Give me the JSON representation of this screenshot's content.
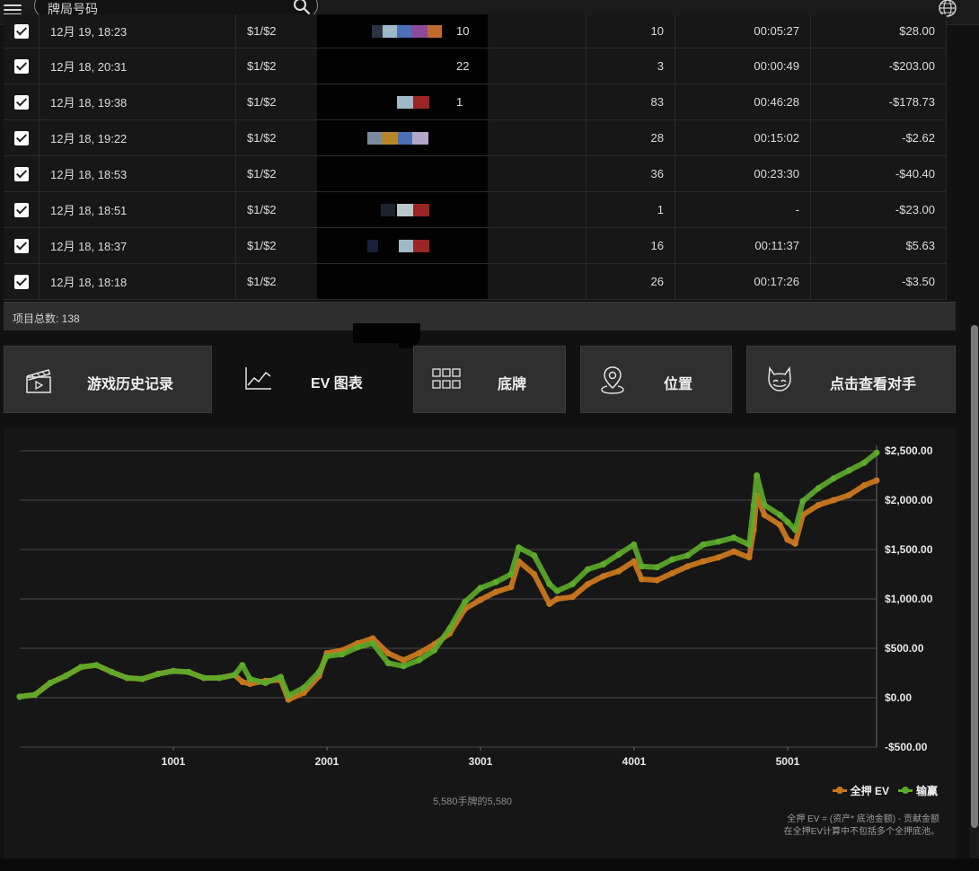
{
  "search": {
    "placeholder": "牌局号码"
  },
  "table": {
    "rows": [
      {
        "date": "12月 19, 18:23",
        "stakes": "$1/$2",
        "tail": "10",
        "hands": "10",
        "duration": "00:05:27",
        "net": "$28.00"
      },
      {
        "date": "12月 18, 20:31",
        "stakes": "$1/$2",
        "tail": "22",
        "hands": "3",
        "duration": "00:00:49",
        "net": "-$203.00"
      },
      {
        "date": "12月 18, 19:38",
        "stakes": "$1/$2",
        "tail": "1",
        "hands": "83",
        "duration": "00:46:28",
        "net": "-$178.73"
      },
      {
        "date": "12月 18, 19:22",
        "stakes": "$1/$2",
        "tail": "",
        "hands": "28",
        "duration": "00:15:02",
        "net": "-$2.62"
      },
      {
        "date": "12月 18, 18:53",
        "stakes": "$1/$2",
        "tail": "",
        "hands": "36",
        "duration": "00:23:30",
        "net": "-$40.40"
      },
      {
        "date": "12月 18, 18:51",
        "stakes": "$1/$2",
        "tail": "",
        "hands": "1",
        "duration": "-",
        "net": "-$23.00"
      },
      {
        "date": "12月 18, 18:37",
        "stakes": "$1/$2",
        "tail": "",
        "hands": "16",
        "duration": "00:11:37",
        "net": "$5.63"
      },
      {
        "date": "12月 18, 18:18",
        "stakes": "$1/$2",
        "tail": "",
        "hands": "26",
        "duration": "00:17:26",
        "net": "-$3.50"
      }
    ],
    "total_label": "项目总数: 138"
  },
  "tabs": {
    "history": "游戏历史记录",
    "ev": "EV 图表",
    "board": "底牌",
    "position": "位置",
    "opponents": "点击查看对手"
  },
  "icons": {
    "menu": "hamburger-menu-icon",
    "search": "search-icon",
    "globe": "globe-icon",
    "history": "clapperboard-icon",
    "ev": "line-chart-icon",
    "board": "grid-icon",
    "position": "location-pin-icon",
    "opponents": "cat-face-icon"
  },
  "colors": {
    "allin_ev": "#c8761e",
    "winnings": "#5dab2a",
    "background": "#111111"
  },
  "chart_meta": {
    "hand_count": "5,580手牌的5,580",
    "footnote_line1": "全押 EV = (资产* 底池金额) - 贡献金额",
    "footnote_line2": "在全押EV计算中不包括多个全押底池。"
  },
  "chart_data": {
    "type": "line",
    "title": "",
    "xlabel": "",
    "ylabel": "",
    "x_ticks": [
      "1001",
      "2001",
      "3001",
      "4001",
      "5001"
    ],
    "y_ticks": [
      "$2,500.00",
      "$2,000.00",
      "$1,500.00",
      "$1,000.00",
      "$500.00",
      "$0.00",
      "-$500.00"
    ],
    "xlim": [
      1,
      5580
    ],
    "ylim": [
      -500,
      2500
    ],
    "grid": true,
    "legend_position": "bottom-right",
    "series": [
      {
        "name": "全押 EV",
        "color": "#c8761e",
        "x": [
          1,
          100,
          200,
          300,
          400,
          500,
          600,
          700,
          800,
          900,
          1000,
          1100,
          1200,
          1300,
          1400,
          1450,
          1500,
          1600,
          1700,
          1750,
          1850,
          1950,
          2000,
          2100,
          2200,
          2300,
          2400,
          2500,
          2600,
          2700,
          2800,
          2900,
          3000,
          3100,
          3200,
          3250,
          3350,
          3450,
          3500,
          3600,
          3700,
          3800,
          3900,
          4000,
          4050,
          4150,
          4250,
          4350,
          4450,
          4550,
          4650,
          4750,
          4780,
          4800,
          4850,
          4950,
          5000,
          5050,
          5100,
          5200,
          5300,
          5400,
          5500,
          5580
        ],
        "y": [
          10,
          30,
          150,
          220,
          310,
          330,
          260,
          200,
          190,
          240,
          270,
          260,
          200,
          200,
          230,
          160,
          140,
          170,
          180,
          -20,
          50,
          220,
          450,
          480,
          550,
          600,
          450,
          380,
          450,
          540,
          650,
          900,
          990,
          1070,
          1120,
          1380,
          1250,
          950,
          1000,
          1020,
          1150,
          1230,
          1280,
          1380,
          1200,
          1190,
          1260,
          1330,
          1380,
          1420,
          1480,
          1420,
          1700,
          2050,
          1850,
          1750,
          1600,
          1560,
          1850,
          1950,
          2000,
          2050,
          2150,
          2200
        ]
      },
      {
        "name": "输赢",
        "color": "#5dab2a",
        "x": [
          1,
          100,
          200,
          300,
          400,
          500,
          600,
          700,
          800,
          900,
          1000,
          1100,
          1200,
          1300,
          1400,
          1450,
          1500,
          1600,
          1700,
          1750,
          1850,
          1950,
          2000,
          2100,
          2200,
          2300,
          2400,
          2500,
          2600,
          2700,
          2800,
          2900,
          3000,
          3100,
          3200,
          3250,
          3350,
          3450,
          3500,
          3600,
          3700,
          3800,
          3900,
          4000,
          4050,
          4150,
          4250,
          4350,
          4450,
          4550,
          4650,
          4750,
          4780,
          4800,
          4850,
          4950,
          5000,
          5050,
          5100,
          5200,
          5300,
          5400,
          5500,
          5580
        ],
        "y": [
          10,
          30,
          150,
          220,
          310,
          330,
          260,
          200,
          190,
          240,
          270,
          260,
          200,
          200,
          230,
          330,
          190,
          150,
          210,
          20,
          100,
          260,
          420,
          440,
          510,
          550,
          350,
          320,
          380,
          480,
          700,
          970,
          1110,
          1170,
          1250,
          1520,
          1440,
          1150,
          1080,
          1150,
          1300,
          1350,
          1450,
          1550,
          1330,
          1320,
          1400,
          1440,
          1550,
          1580,
          1620,
          1550,
          1950,
          2250,
          1950,
          1850,
          1780,
          1700,
          1990,
          2120,
          2220,
          2300,
          2380,
          2480
        ]
      }
    ]
  }
}
